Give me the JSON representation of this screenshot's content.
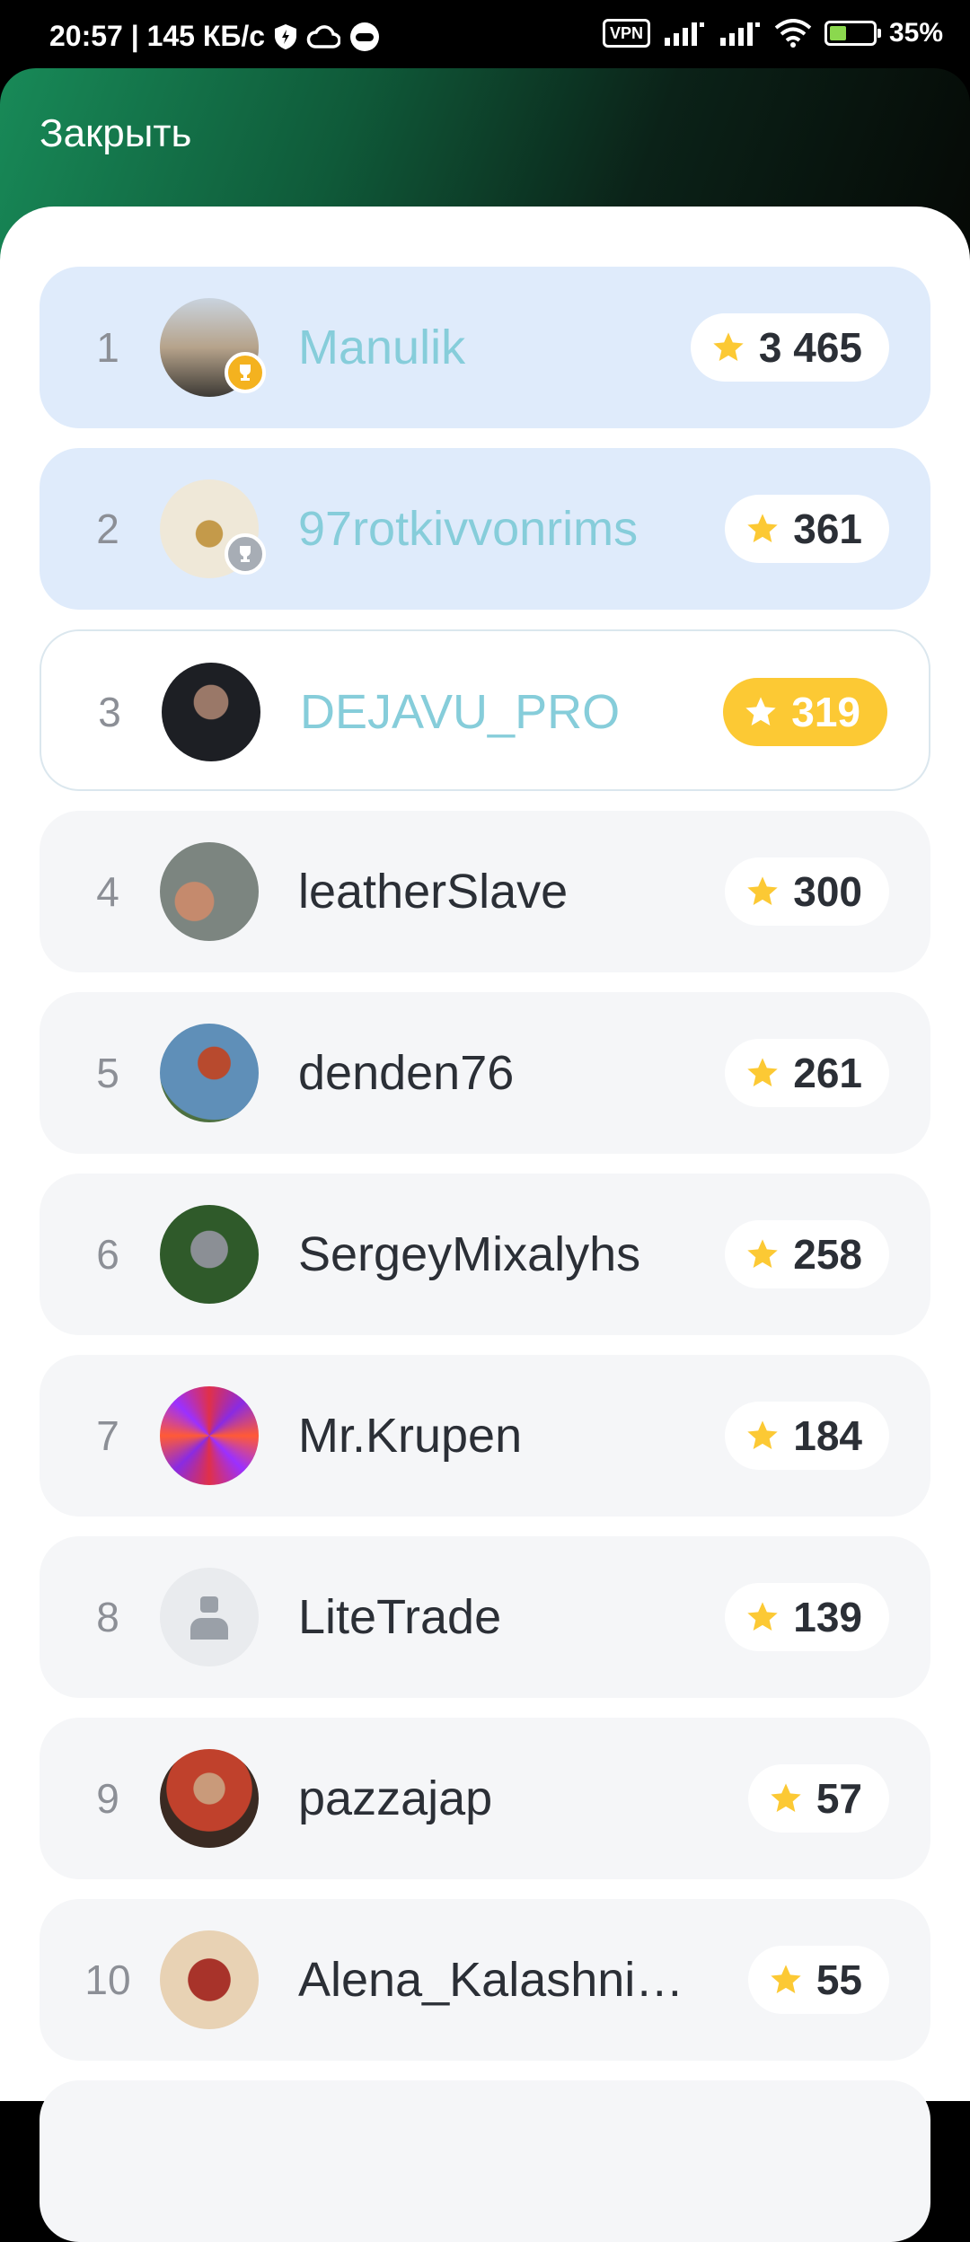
{
  "status_bar": {
    "left_text": "20:57 | 145 КБ/с",
    "vpn": "VPN",
    "battery": "35%"
  },
  "header": {
    "close_label": "Закрыть"
  },
  "colors": {
    "highlight_name": "#86cdda",
    "star": "#fcc934",
    "top_row_bg": "#dfebfb"
  },
  "leaderboard": [
    {
      "rank": "1",
      "name": "Manulik",
      "score": "3 465",
      "badge": "gold-trophy",
      "style": "top"
    },
    {
      "rank": "2",
      "name": "97rotkivvonrims",
      "score": "361",
      "badge": "silver-trophy",
      "style": "top"
    },
    {
      "rank": "3",
      "name": "DEJAVU_PRO",
      "score": "319",
      "badge": "",
      "style": "me"
    },
    {
      "rank": "4",
      "name": "leatherSlave",
      "score": "300"
    },
    {
      "rank": "5",
      "name": "denden76",
      "score": "261"
    },
    {
      "rank": "6",
      "name": "SergeyMixalyhs",
      "score": "258"
    },
    {
      "rank": "7",
      "name": "Mr.Krupen",
      "score": "184"
    },
    {
      "rank": "8",
      "name": "LiteTrade",
      "score": "139"
    },
    {
      "rank": "9",
      "name": "pazzajap",
      "score": "57"
    },
    {
      "rank": "10",
      "name": "Alena_Kalashni…",
      "score": "55"
    }
  ]
}
